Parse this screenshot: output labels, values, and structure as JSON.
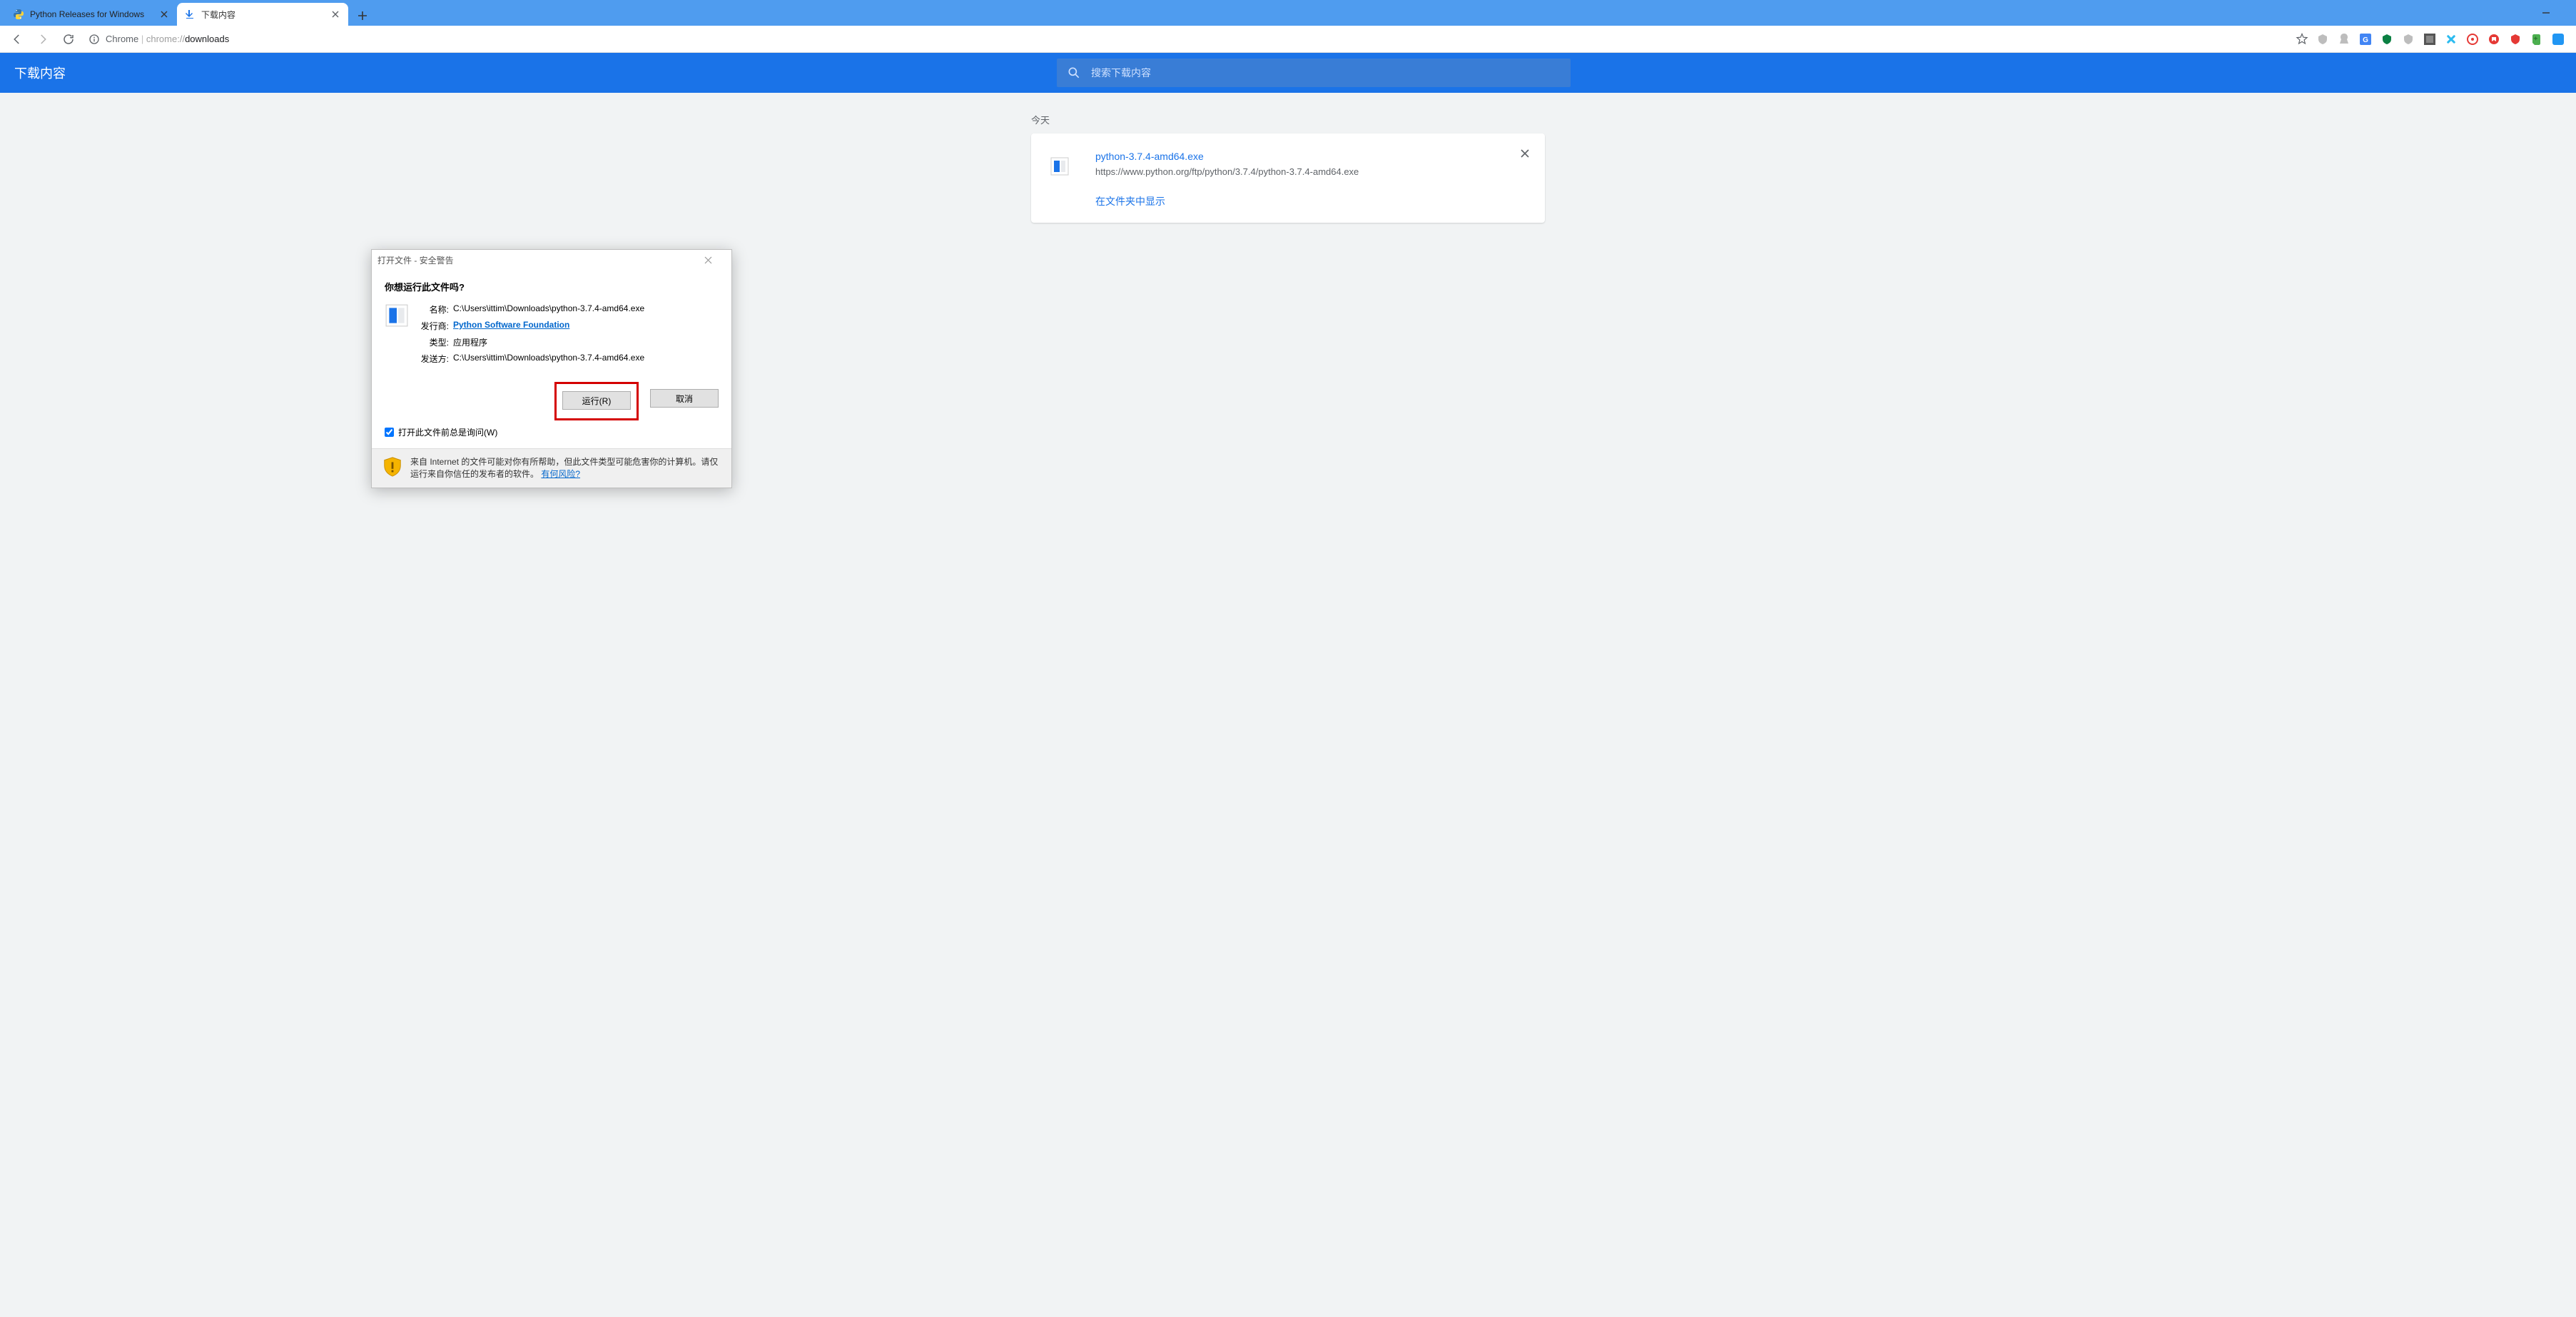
{
  "tabs": [
    {
      "title": "Python Releases for Windows",
      "active": false
    },
    {
      "title": "下载内容",
      "active": true
    }
  ],
  "omnibox": {
    "prefix": "Chrome",
    "host": "chrome://",
    "path": "downloads"
  },
  "downloads_page": {
    "header_title": "下载内容",
    "search_placeholder": "搜索下载内容",
    "today_label": "今天",
    "item": {
      "filename": "python-3.7.4-amd64.exe",
      "url": "https://www.python.org/ftp/python/3.7.4/python-3.7.4-amd64.exe",
      "show_in_folder": "在文件夹中显示"
    }
  },
  "dialog": {
    "title": "打开文件 - 安全警告",
    "question": "你想运行此文件吗?",
    "labels": {
      "name": "名称:",
      "publisher": "发行商:",
      "type": "类型:",
      "from": "发送方:"
    },
    "values": {
      "name": "C:\\Users\\ittim\\Downloads\\python-3.7.4-amd64.exe",
      "publisher": "Python Software Foundation",
      "type": "应用程序",
      "from": "C:\\Users\\ittim\\Downloads\\python-3.7.4-amd64.exe"
    },
    "buttons": {
      "run": "运行(R)",
      "cancel": "取消"
    },
    "always_ask": "打开此文件前总是询问(W)",
    "footer_text_a": "来自 Internet 的文件可能对你有所帮助，但此文件类型可能危害你的计算机。请仅运行来自你信任的发布者的软件。",
    "footer_link": "有何风险?"
  }
}
